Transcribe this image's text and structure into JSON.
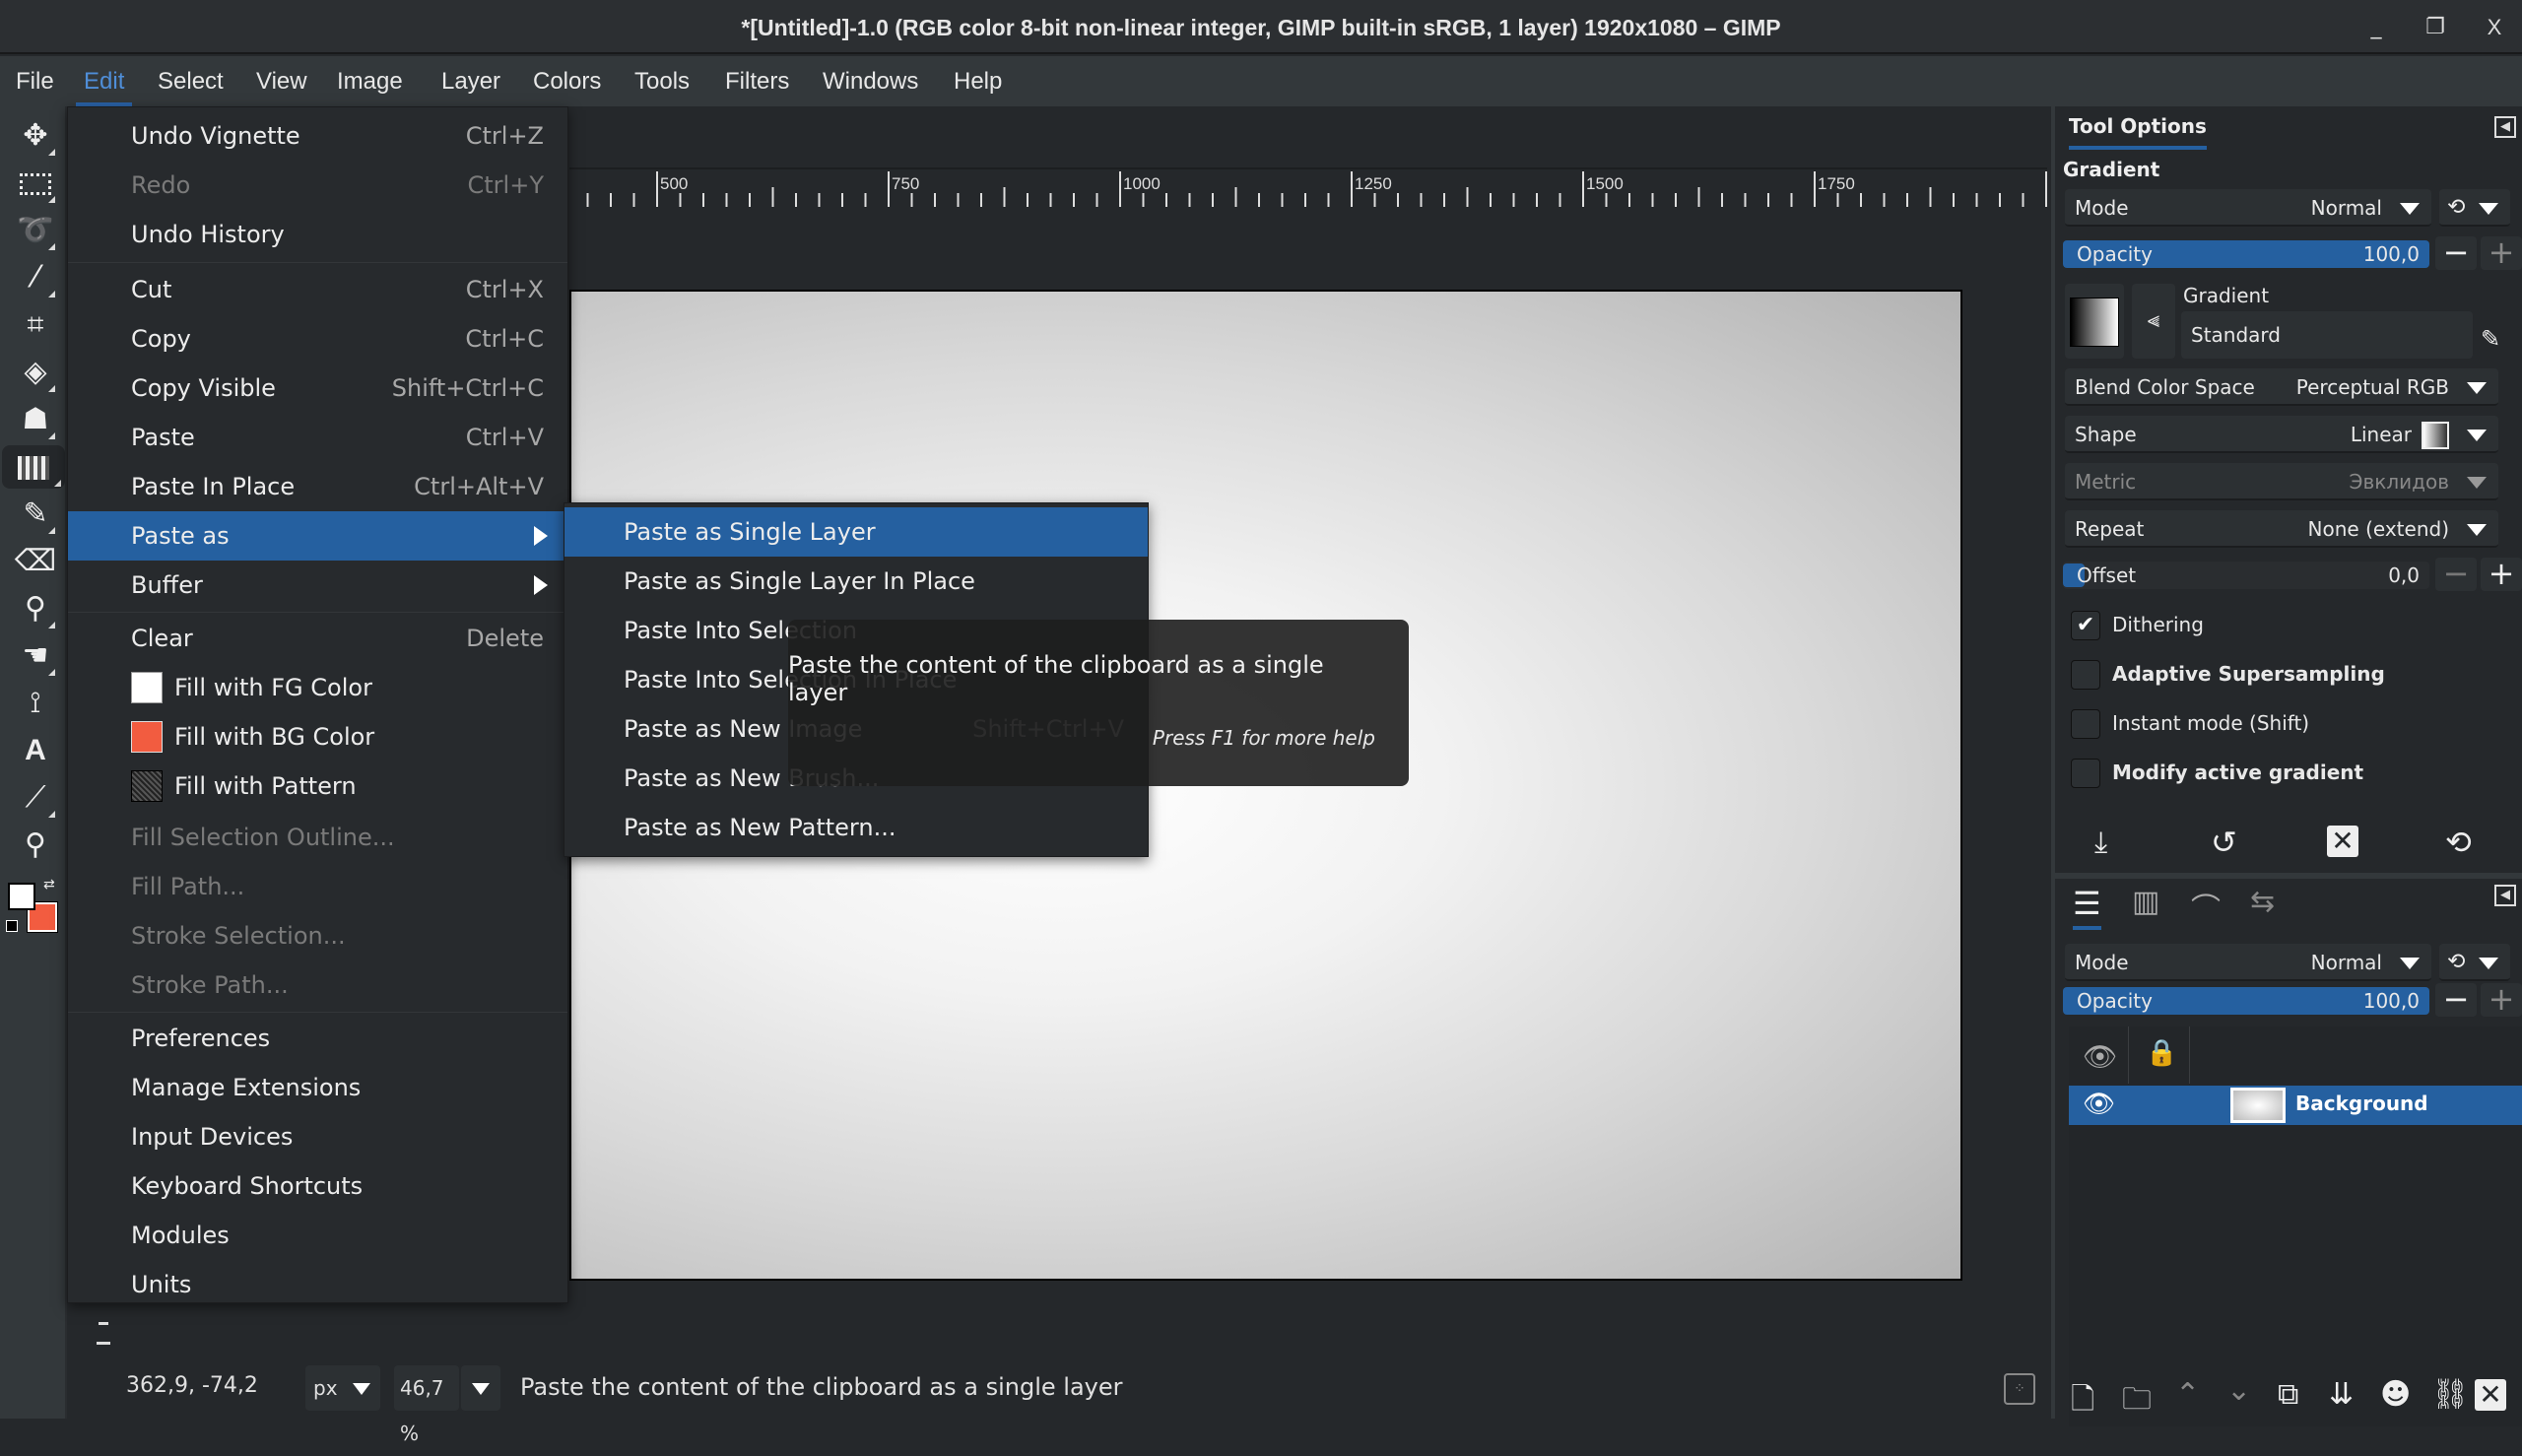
{
  "window": {
    "title": "*[Untitled]-1.0 (RGB color 8-bit non-linear integer, GIMP built-in sRGB, 1 layer) 1920x1080 – GIMP",
    "controls": {
      "minimize": "_",
      "maximize": "❐",
      "close": "X"
    }
  },
  "menubar": {
    "items": [
      "File",
      "Edit",
      "Select",
      "View",
      "Image",
      "Layer",
      "Colors",
      "Tools",
      "Filters",
      "Windows",
      "Help"
    ],
    "active": "Edit"
  },
  "edit_menu": {
    "items": [
      {
        "label": "Undo Vignette",
        "accel": "Ctrl+Z"
      },
      {
        "label": "Redo",
        "accel": "Ctrl+Y",
        "disabled": true
      },
      {
        "label": "Undo History",
        "accel": ""
      },
      {
        "label": "Cut",
        "accel": "Ctrl+X"
      },
      {
        "label": "Copy",
        "accel": "Ctrl+C"
      },
      {
        "label": "Copy Visible",
        "accel": "Shift+Ctrl+C"
      },
      {
        "label": "Paste",
        "accel": "Ctrl+V"
      },
      {
        "label": "Paste In Place",
        "accel": "Ctrl+Alt+V"
      },
      {
        "label": "Paste as",
        "accel": "",
        "submenu": true,
        "highlighted": true
      },
      {
        "label": "Buffer",
        "accel": "",
        "submenu": true
      },
      {
        "label": "Clear",
        "accel": "Delete"
      },
      {
        "label": "Fill with FG Color",
        "swatch": "#ffffff"
      },
      {
        "label": "Fill with BG Color",
        "swatch": "#f25c40"
      },
      {
        "label": "Fill with Pattern",
        "swatch": "pattern"
      },
      {
        "label": "Fill Selection Outline...",
        "disabled": true
      },
      {
        "label": "Fill Path...",
        "disabled": true
      },
      {
        "label": "Stroke Selection...",
        "disabled": true
      },
      {
        "label": "Stroke Path...",
        "disabled": true
      },
      {
        "label": "Preferences"
      },
      {
        "label": "Manage Extensions"
      },
      {
        "label": "Input Devices"
      },
      {
        "label": "Keyboard Shortcuts"
      },
      {
        "label": "Modules"
      },
      {
        "label": "Units"
      }
    ]
  },
  "paste_as_submenu": {
    "items": [
      {
        "label": "Paste as Single Layer",
        "accel": "",
        "highlighted": true
      },
      {
        "label": "Paste as Single Layer In Place",
        "accel": ""
      },
      {
        "label": "Paste Into Selection",
        "accel": ""
      },
      {
        "label": "Paste Into Selection In Place",
        "accel": ""
      },
      {
        "label": "Paste as New Image",
        "accel": "Shift+Ctrl+V"
      },
      {
        "label": "Paste as New Brush...",
        "accel": ""
      },
      {
        "label": "Paste as New Pattern...",
        "accel": ""
      }
    ]
  },
  "tooltip": {
    "text": "Paste the content of the clipboard as a single layer",
    "help": "Press F1 for more help"
  },
  "ruler": {
    "labels": [
      "500",
      "750",
      "1000",
      "1250",
      "1500",
      "1750"
    ]
  },
  "toolbox": {
    "tools": [
      "move-icon",
      "rect-select-icon",
      "lasso-icon",
      "fuzzy-select-icon",
      "crop-icon",
      "transform-icon",
      "warp-icon",
      "gradient-icon",
      "pencil-icon",
      "eraser-icon",
      "clone-icon",
      "smudge-icon",
      "paths-icon",
      "text-icon",
      "color-picker-icon",
      "zoom-icon"
    ],
    "active": "gradient-icon",
    "fg_color": "#ffffff",
    "bg_color": "#f25c40"
  },
  "tool_options": {
    "tab": "Tool Options",
    "title": "Gradient",
    "mode": {
      "label": "Mode",
      "value": "Normal"
    },
    "opacity": {
      "label": "Opacity",
      "value": "100,0",
      "fraction": 1.0
    },
    "gradient": {
      "label": "Gradient",
      "value": "Standard"
    },
    "blend_color_space": {
      "label": "Blend Color Space",
      "value": "Perceptual RGB"
    },
    "shape": {
      "label": "Shape",
      "value": "Linear"
    },
    "metric": {
      "label": "Metric",
      "value": "Эвклидов",
      "disabled": true
    },
    "repeat": {
      "label": "Repeat",
      "value": "None (extend)"
    },
    "offset": {
      "label": "Offset",
      "value": "0,0",
      "fraction": 0.0
    },
    "checkboxes": [
      {
        "label": "Dithering",
        "checked": true,
        "bold": false
      },
      {
        "label": "Adaptive Supersampling",
        "checked": false,
        "bold": true
      },
      {
        "label": "Instant mode  (Shift)",
        "checked": false,
        "bold": false
      },
      {
        "label": "Modify active gradient",
        "checked": false,
        "bold": true
      }
    ]
  },
  "layers": {
    "mode": {
      "label": "Mode",
      "value": "Normal"
    },
    "opacity": {
      "label": "Opacity",
      "value": "100,0",
      "fraction": 1.0
    },
    "items": [
      {
        "name": "Background",
        "visible": true,
        "selected": true
      }
    ]
  },
  "status": {
    "coords": "362,9, -74,2",
    "unit": "px",
    "zoom": "46,7 %",
    "message": "Paste the content of the clipboard as a single layer"
  },
  "colors": {
    "accent": "#2560a0",
    "selection": "#e8e800"
  }
}
